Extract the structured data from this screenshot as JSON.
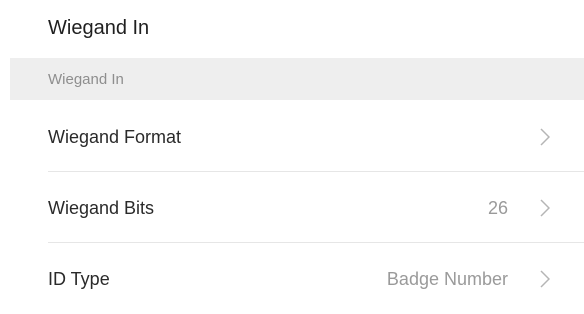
{
  "page": {
    "title": "Wiegand In"
  },
  "section": {
    "header": "Wiegand In"
  },
  "rows": [
    {
      "label": "Wiegand Format",
      "value": ""
    },
    {
      "label": "Wiegand Bits",
      "value": "26"
    },
    {
      "label": "ID Type",
      "value": "Badge Number"
    }
  ],
  "icons": {
    "chevron": "chevron-right-icon"
  },
  "colors": {
    "background": "#ffffff",
    "section_bg": "#eeeeee",
    "text_primary": "#2a2a2a",
    "text_secondary": "#9a9a9a",
    "chevron": "#b5b5b5"
  }
}
